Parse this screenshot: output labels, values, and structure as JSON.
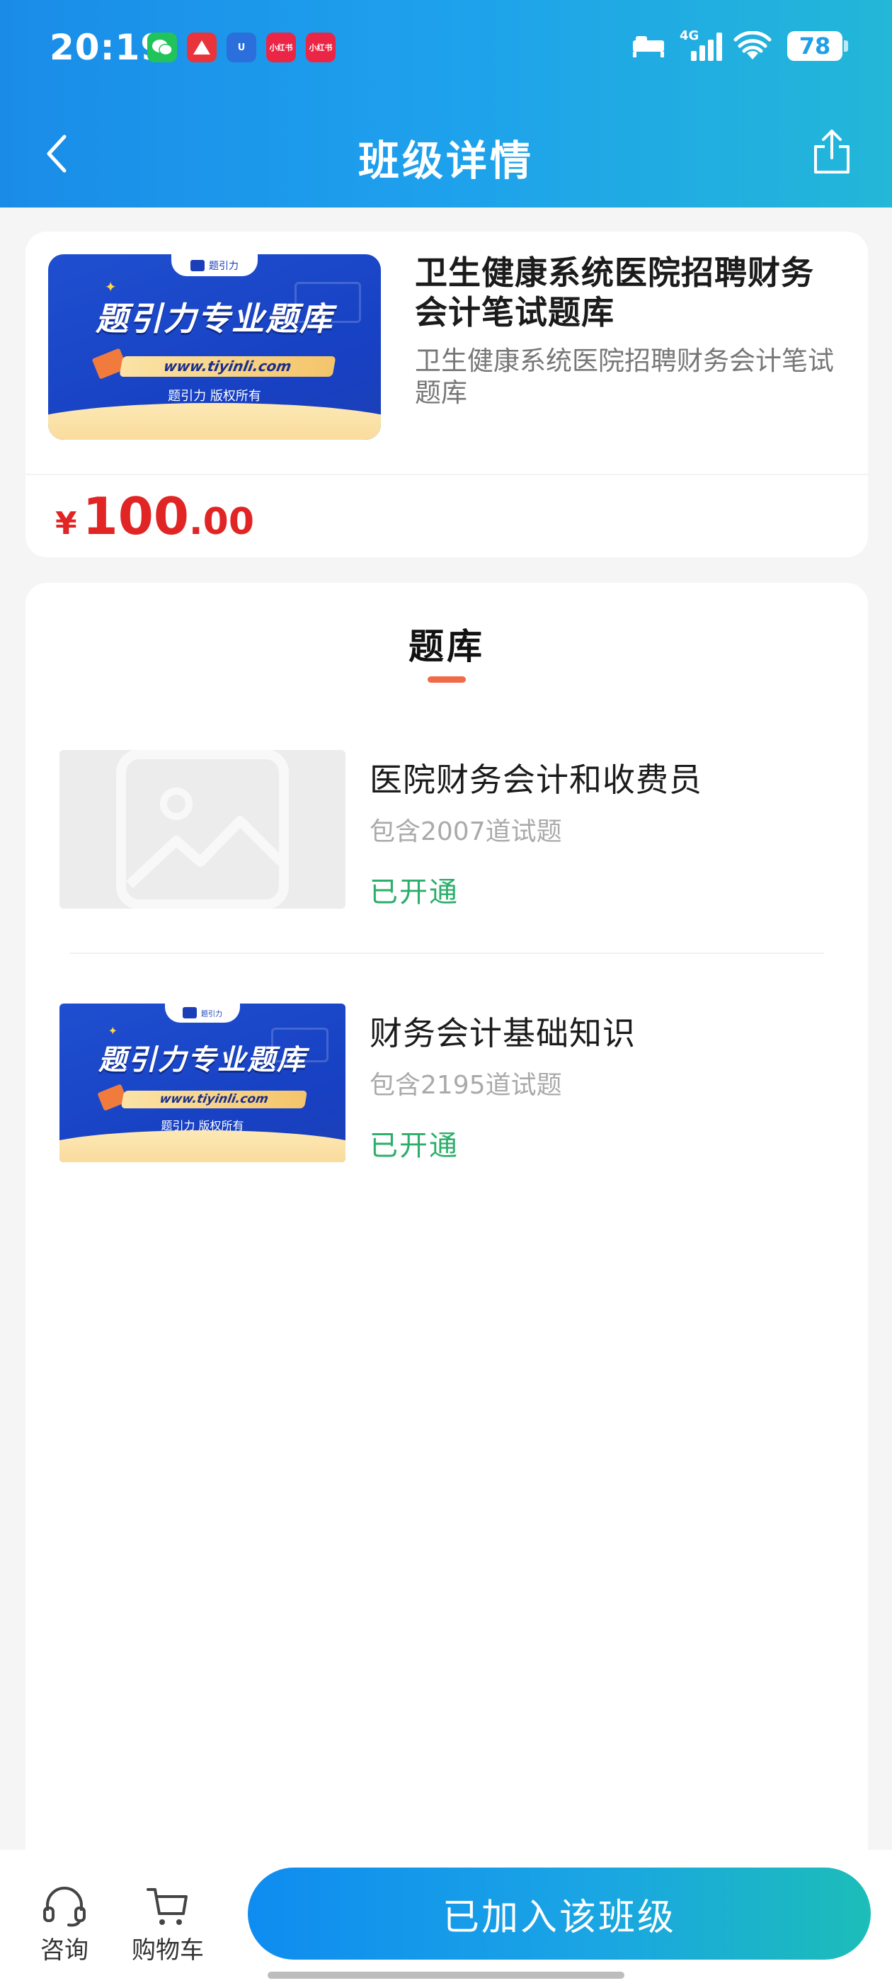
{
  "status_bar": {
    "time": "20:19",
    "network": "4G",
    "battery": "78",
    "notification_icons": [
      "wechat-icon",
      "a-app-icon",
      "u-app-icon",
      "xiaohongshu-icon",
      "xiaohongshu-icon"
    ],
    "notification_labels": [
      "",
      "",
      "U",
      "小红书",
      "小红书"
    ]
  },
  "nav": {
    "title": "班级详情"
  },
  "banner": {
    "tab_label": "题引力",
    "headline": "题引力专业题库",
    "url": "www.tiyinli.com",
    "copyright": "题引力 版权所有"
  },
  "class_info": {
    "title": "卫生健康系统医院招聘财务会计笔试题库",
    "subtitle": "卫生健康系统医院招聘财务会计笔试题库",
    "price_symbol": "¥",
    "price_int": "100",
    "price_dec": ".00"
  },
  "section": {
    "title": "题库"
  },
  "question_banks": [
    {
      "name": "医院财务会计和收费员",
      "count": "包含2007道试题",
      "status": "已开通"
    },
    {
      "name": "财务会计基础知识",
      "count": "包含2195道试题",
      "status": "已开通"
    }
  ],
  "bottom_bar": {
    "consult_label": "咨询",
    "cart_label": "购物车",
    "join_label": "已加入该班级"
  },
  "colors": {
    "header_gradient_start": "#1a8ce8",
    "header_gradient_end": "#23b7d8",
    "price": "#e12525",
    "status_green": "#2dae6b",
    "accent_underline": "#ef6a47"
  }
}
